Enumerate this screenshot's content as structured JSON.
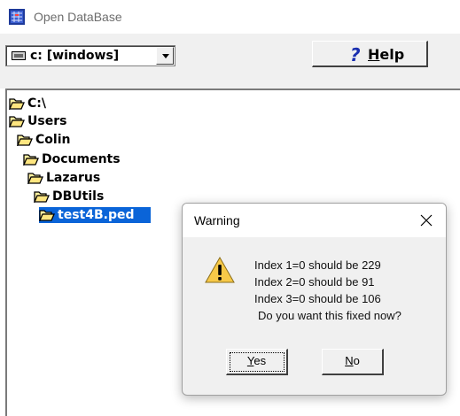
{
  "window": {
    "title": "Open DataBase",
    "icon": "database-app-icon"
  },
  "toolbar": {
    "drive": {
      "icon": "drive-icon",
      "selected": "c: [windows]"
    },
    "help": {
      "icon": "question-mark-icon",
      "question_glyph": "?",
      "mnemonic": "H",
      "rest": "elp"
    }
  },
  "tree": {
    "items": [
      {
        "label": "C:\\",
        "icon": "open-folder-icon",
        "selected": false
      },
      {
        "label": "Users",
        "icon": "open-folder-icon",
        "selected": false
      },
      {
        "label": "Colin",
        "icon": "open-folder-icon",
        "selected": false
      },
      {
        "label": "Documents",
        "icon": "open-folder-icon",
        "selected": false
      },
      {
        "label": "Lazarus",
        "icon": "open-folder-icon",
        "selected": false
      },
      {
        "label": "DBUtils",
        "icon": "open-folder-icon",
        "selected": false
      },
      {
        "label": "test4B.ped",
        "icon": "open-folder-icon",
        "selected": true
      }
    ],
    "selection_color": "#0a64d8"
  },
  "dialog": {
    "title": "Warning",
    "close_icon": "close-icon",
    "icon": "warning-icon",
    "lines": [
      "Index 1=0 should be 229",
      "Index 2=0 should be 91",
      "Index 3=0 should be 106",
      "Do you want this fixed now?"
    ],
    "yes": {
      "mnemonic": "Y",
      "rest": "es"
    },
    "no": {
      "mnemonic": "N",
      "rest": "o"
    }
  }
}
